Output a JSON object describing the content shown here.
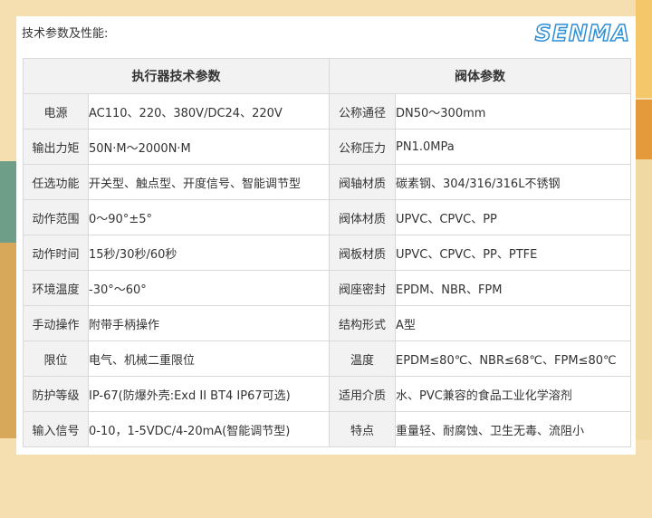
{
  "page": {
    "heading": "技术参数及性能:",
    "logo_text": "SENMA"
  },
  "table": {
    "headers": {
      "actuator": "执行器技术参数",
      "valve": "阀体参数"
    },
    "rows": [
      {
        "a_label": "电源",
        "a_value": "AC110、220、380V/DC24、220V",
        "v_label": "公称通径",
        "v_value": "DN50～300mm"
      },
      {
        "a_label": "输出力矩",
        "a_value": "50N·M～2000N·M",
        "v_label": "公称压力",
        "v_value": "PN1.0MPa"
      },
      {
        "a_label": "任选功能",
        "a_value": "开关型、触点型、开度信号、智能调节型",
        "v_label": "阀轴材质",
        "v_value": "碳素钢、304/316/316L不锈钢"
      },
      {
        "a_label": "动作范围",
        "a_value": "0～90°±5°",
        "v_label": "阀体材质",
        "v_value": "UPVC、CPVC、PP"
      },
      {
        "a_label": "动作时间",
        "a_value": "15秒/30秒/60秒",
        "v_label": "阀板材质",
        "v_value": "UPVC、CPVC、PP、PTFE"
      },
      {
        "a_label": "环境温度",
        "a_value": "-30°～60°",
        "v_label": "阀座密封",
        "v_value": "EPDM、NBR、FPM"
      },
      {
        "a_label": "手动操作",
        "a_value": "附带手柄操作",
        "v_label": "结构形式",
        "v_value": "A型"
      },
      {
        "a_label": "限位",
        "a_value": "电气、机械二重限位",
        "v_label": "温度",
        "v_value": "EPDM≤80℃、NBR≤68℃、FPM≤80℃"
      },
      {
        "a_label": "防护等级",
        "a_value": "IP-67(防爆外壳:Exd II BT4 IP67可选)",
        "v_label": "适用介质",
        "v_value": "水、PVC兼容的食品工业化学溶剂"
      },
      {
        "a_label": "输入信号",
        "a_value": "0-10，1-5VDC/4-20mA(智能调节型)",
        "v_label": "特点",
        "v_value": "重量轻、耐腐蚀、卫生无毒、流阻小"
      }
    ]
  }
}
